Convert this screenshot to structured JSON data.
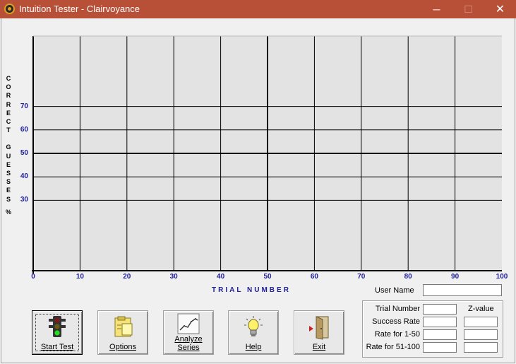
{
  "window": {
    "title": "Intuition Tester - Clairvoyance"
  },
  "colors": {
    "titlebar": "#b85038",
    "axis_text": "#20209a",
    "plot_bg": "#e3e3e3"
  },
  "chart_data": {
    "type": "line",
    "title": "",
    "xlabel": "TRIAL NUMBER",
    "ylabel": "CORRECT GUESSES %",
    "xlim": [
      0,
      100
    ],
    "ylim": [
      0,
      100
    ],
    "x_ticks": [
      0,
      10,
      20,
      30,
      40,
      50,
      60,
      70,
      80,
      90,
      100
    ],
    "y_ticks": [
      30,
      40,
      50,
      60,
      70
    ],
    "grid": true,
    "series": []
  },
  "ylabel_letters": {
    "word1": [
      "C",
      "O",
      "R",
      "R",
      "E",
      "C",
      "T"
    ],
    "word2": [
      "G",
      "U",
      "E",
      "S",
      "S",
      "E",
      "S"
    ],
    "suffix": "%"
  },
  "user": {
    "label": "User Name",
    "value": ""
  },
  "buttons": [
    {
      "label": "Start Test",
      "icon": "traffic-light-icon"
    },
    {
      "label": "Options",
      "icon": "notepad-icon"
    },
    {
      "label_line1": "Analyze",
      "label_line2": "Series",
      "icon": "chart-icon"
    },
    {
      "label": "Help",
      "icon": "lightbulb-icon"
    },
    {
      "label": "Exit",
      "icon": "door-exit-icon"
    }
  ],
  "stats": {
    "trial_number": "Trial Number",
    "success_rate": "Success Rate",
    "rate_1_50": "Rate for 1-50",
    "rate_51_100": "Rate for 51-100",
    "z_value": "Z-value"
  }
}
